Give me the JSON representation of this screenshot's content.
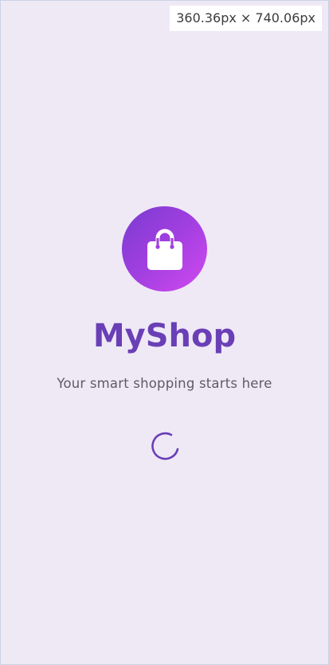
{
  "devtools": {
    "dimensions_label": "360.36px × 740.06px"
  },
  "splash": {
    "app_name": "MyShop",
    "tagline": "Your smart shopping starts here",
    "logo_icon": "shopping-bag-icon",
    "loading_indicator": "circular-progress"
  },
  "colors": {
    "background": "#efe9f6",
    "brand_primary": "#6a3fb6",
    "logo_gradient_start": "#7a3bd0",
    "logo_gradient_end": "#d14af0",
    "spinner": "#6a3fb6"
  }
}
